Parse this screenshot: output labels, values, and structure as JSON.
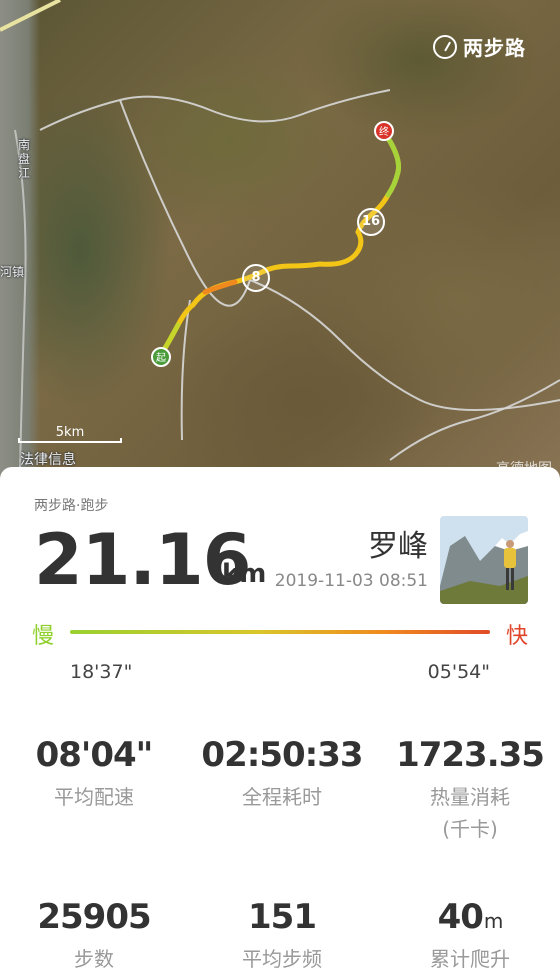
{
  "map": {
    "brand": "两步路",
    "labels": [
      "南盘江",
      "河镇",
      "法律信息"
    ],
    "scale": "5km",
    "provider": "高德地图",
    "start_marker": "起",
    "end_marker": "终",
    "km_markers": [
      "8",
      "16"
    ]
  },
  "card": {
    "source": "两步路·跑步",
    "distance": "21.16",
    "unit": "km",
    "username": "罗峰",
    "datetime": "2019-11-03 08:51",
    "pace_slow_label": "慢",
    "pace_fast_label": "快",
    "pace_min": "18'37\"",
    "pace_max": "05'54\"",
    "stats": [
      {
        "value": "08'04\"",
        "label": "平均配速"
      },
      {
        "value": "02:50:33",
        "label": "全程耗时"
      },
      {
        "value": "1723.35",
        "label": "热量消耗",
        "sublabel": "(千卡)"
      },
      {
        "value": "25905",
        "label": "步数"
      },
      {
        "value": "151",
        "label": "平均步频"
      },
      {
        "value": "40",
        "unit": "m",
        "label": "累计爬升"
      }
    ]
  },
  "colors": {
    "slow": "#8fd02c",
    "fast": "#e0452a",
    "start_marker": "#4a9b3a",
    "end_marker": "#d9342b"
  }
}
